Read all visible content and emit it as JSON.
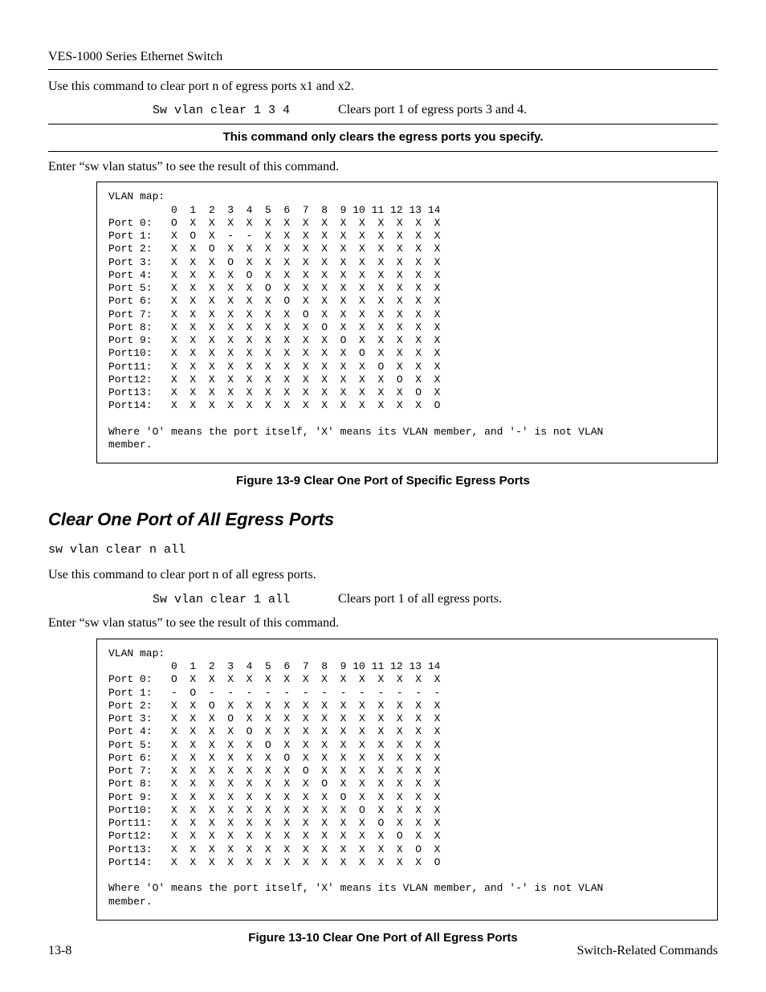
{
  "header": "VES-1000 Series Ethernet Switch",
  "intro": "Use this command to clear port n of egress ports x1 and x2.",
  "example1": {
    "cmd": "Sw vlan clear 1 3 4",
    "desc": "Clears port 1 of egress ports 3 and 4."
  },
  "callout": "This command only clears the egress ports you specify.",
  "status_line": "Enter “sw vlan status” to see the result of this command.",
  "vlan_map1": "VLAN map:\n          0  1  2  3  4  5  6  7  8  9 10 11 12 13 14\nPort 0:   O  X  X  X  X  X  X  X  X  X  X  X  X  X  X\nPort 1:   X  O  X  -  -  X  X  X  X  X  X  X  X  X  X\nPort 2:   X  X  O  X  X  X  X  X  X  X  X  X  X  X  X\nPort 3:   X  X  X  O  X  X  X  X  X  X  X  X  X  X  X\nPort 4:   X  X  X  X  O  X  X  X  X  X  X  X  X  X  X\nPort 5:   X  X  X  X  X  O  X  X  X  X  X  X  X  X  X\nPort 6:   X  X  X  X  X  X  O  X  X  X  X  X  X  X  X\nPort 7:   X  X  X  X  X  X  X  O  X  X  X  X  X  X  X\nPort 8:   X  X  X  X  X  X  X  X  O  X  X  X  X  X  X\nPort 9:   X  X  X  X  X  X  X  X  X  O  X  X  X  X  X\nPort10:   X  X  X  X  X  X  X  X  X  X  O  X  X  X  X\nPort11:   X  X  X  X  X  X  X  X  X  X  X  O  X  X  X\nPort12:   X  X  X  X  X  X  X  X  X  X  X  X  O  X  X\nPort13:   X  X  X  X  X  X  X  X  X  X  X  X  X  O  X\nPort14:   X  X  X  X  X  X  X  X  X  X  X  X  X  X  O\n\nWhere 'O' means the port itself, 'X' means its VLAN member, and '-' is not VLAN\nmember.",
  "fig1_caption": "Figure 13-9 Clear One Port of Specific Egress Ports",
  "section2": {
    "title": "Clear One Port of All Egress Ports",
    "syntax": "sw vlan clear n all",
    "desc": "Use this command to clear port n of all egress ports."
  },
  "example2": {
    "cmd": "Sw vlan clear 1 all",
    "desc": "Clears port 1 of all egress ports."
  },
  "status_line2": "Enter “sw vlan status” to see the result of this command.",
  "vlan_map2": "VLAN map:\n          0  1  2  3  4  5  6  7  8  9 10 11 12 13 14\nPort 0:   O  X  X  X  X  X  X  X  X  X  X  X  X  X  X\nPort 1:   -  O  -  -  -  -  -  -  -  -  -  -  -  -  -\nPort 2:   X  X  O  X  X  X  X  X  X  X  X  X  X  X  X\nPort 3:   X  X  X  O  X  X  X  X  X  X  X  X  X  X  X\nPort 4:   X  X  X  X  O  X  X  X  X  X  X  X  X  X  X\nPort 5:   X  X  X  X  X  O  X  X  X  X  X  X  X  X  X\nPort 6:   X  X  X  X  X  X  O  X  X  X  X  X  X  X  X\nPort 7:   X  X  X  X  X  X  X  O  X  X  X  X  X  X  X\nPort 8:   X  X  X  X  X  X  X  X  O  X  X  X  X  X  X\nPort 9:   X  X  X  X  X  X  X  X  X  O  X  X  X  X  X\nPort10:   X  X  X  X  X  X  X  X  X  X  O  X  X  X  X\nPort11:   X  X  X  X  X  X  X  X  X  X  X  O  X  X  X\nPort12:   X  X  X  X  X  X  X  X  X  X  X  X  O  X  X\nPort13:   X  X  X  X  X  X  X  X  X  X  X  X  X  O  X\nPort14:   X  X  X  X  X  X  X  X  X  X  X  X  X  X  O\n\nWhere 'O' means the port itself, 'X' means its VLAN member, and '-' is not VLAN\nmember.",
  "fig2_caption": "Figure 13-10 Clear One Port of All Egress Ports",
  "footer": {
    "left": "13-8",
    "right": "Switch-Related Commands"
  }
}
